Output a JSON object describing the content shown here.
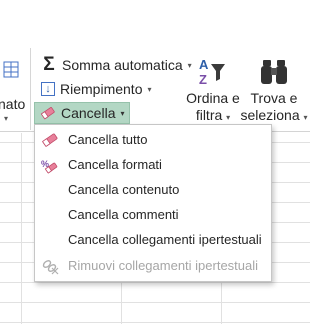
{
  "ribbon": {
    "format": {
      "label": "nato",
      "icon": "format-cells-icon"
    },
    "autosum": {
      "label": "Somma automatica",
      "icon": "sigma-icon"
    },
    "fill": {
      "label": "Riempimento",
      "icon": "fill-down-icon"
    },
    "clear": {
      "label": "Cancella",
      "icon": "eraser-icon"
    },
    "sort": {
      "label_line1": "Ordina e",
      "label_line2": "filtra",
      "icon": "sort-filter-icon"
    },
    "find": {
      "label_line1": "Trova e",
      "label_line2": "seleziona",
      "icon": "binoculars-icon"
    }
  },
  "clear_menu": {
    "items": [
      {
        "label": "Cancella tutto",
        "icon": "eraser-icon",
        "disabled": false
      },
      {
        "label": "Cancella formati",
        "icon": "clear-formats-icon",
        "disabled": false
      },
      {
        "label": "Cancella contenuto",
        "icon": "",
        "disabled": false
      },
      {
        "label": "Cancella commenti",
        "icon": "",
        "disabled": false
      },
      {
        "label": "Cancella collegamenti ipertestuali",
        "icon": "",
        "disabled": false
      },
      {
        "label": "Rimuovi collegamenti ipertestuali",
        "icon": "remove-hyperlink-icon",
        "disabled": true
      }
    ]
  },
  "colors": {
    "accent_selected": "#b3d7c4",
    "eraser_pink": "#e0607e",
    "icon_blue": "#2e5fa8",
    "disabled_text": "#a6a6a6"
  }
}
